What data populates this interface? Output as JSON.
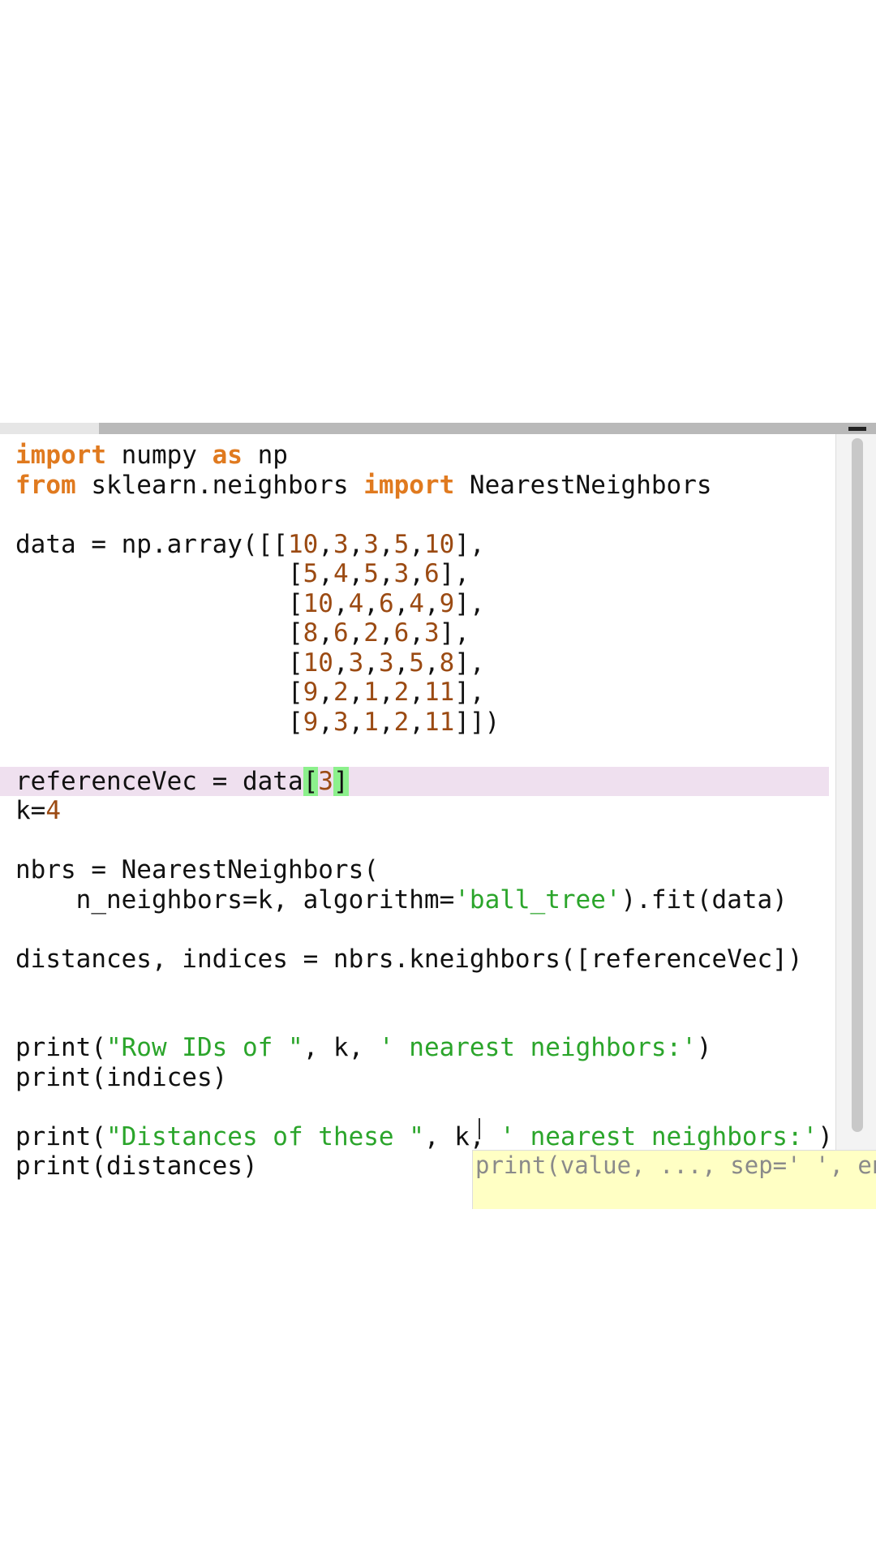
{
  "editor": {
    "highlighted_line": 10,
    "lines": [
      [
        {
          "c": "kw",
          "t": "import"
        },
        {
          "c": "",
          "t": " numpy "
        },
        {
          "c": "kw",
          "t": "as"
        },
        {
          "c": "",
          "t": " np"
        }
      ],
      [
        {
          "c": "kw",
          "t": "from"
        },
        {
          "c": "",
          "t": " sklearn.neighbors "
        },
        {
          "c": "kw",
          "t": "import"
        },
        {
          "c": "",
          "t": " NearestNeighbors"
        }
      ],
      [],
      [
        {
          "c": "",
          "t": "data = np.array([["
        },
        {
          "c": "num",
          "t": "10"
        },
        {
          "c": "",
          "t": ","
        },
        {
          "c": "num",
          "t": "3"
        },
        {
          "c": "",
          "t": ","
        },
        {
          "c": "num",
          "t": "3"
        },
        {
          "c": "",
          "t": ","
        },
        {
          "c": "num",
          "t": "5"
        },
        {
          "c": "",
          "t": ","
        },
        {
          "c": "num",
          "t": "10"
        },
        {
          "c": "",
          "t": "],"
        }
      ],
      [
        {
          "c": "",
          "t": "                  ["
        },
        {
          "c": "num",
          "t": "5"
        },
        {
          "c": "",
          "t": ","
        },
        {
          "c": "num",
          "t": "4"
        },
        {
          "c": "",
          "t": ","
        },
        {
          "c": "num",
          "t": "5"
        },
        {
          "c": "",
          "t": ","
        },
        {
          "c": "num",
          "t": "3"
        },
        {
          "c": "",
          "t": ","
        },
        {
          "c": "num",
          "t": "6"
        },
        {
          "c": "",
          "t": "],"
        }
      ],
      [
        {
          "c": "",
          "t": "                  ["
        },
        {
          "c": "num",
          "t": "10"
        },
        {
          "c": "",
          "t": ","
        },
        {
          "c": "num",
          "t": "4"
        },
        {
          "c": "",
          "t": ","
        },
        {
          "c": "num",
          "t": "6"
        },
        {
          "c": "",
          "t": ","
        },
        {
          "c": "num",
          "t": "4"
        },
        {
          "c": "",
          "t": ","
        },
        {
          "c": "num",
          "t": "9"
        },
        {
          "c": "",
          "t": "],"
        }
      ],
      [
        {
          "c": "",
          "t": "                  ["
        },
        {
          "c": "num",
          "t": "8"
        },
        {
          "c": "",
          "t": ","
        },
        {
          "c": "num",
          "t": "6"
        },
        {
          "c": "",
          "t": ","
        },
        {
          "c": "num",
          "t": "2"
        },
        {
          "c": "",
          "t": ","
        },
        {
          "c": "num",
          "t": "6"
        },
        {
          "c": "",
          "t": ","
        },
        {
          "c": "num",
          "t": "3"
        },
        {
          "c": "",
          "t": "],"
        }
      ],
      [
        {
          "c": "",
          "t": "                  ["
        },
        {
          "c": "num",
          "t": "10"
        },
        {
          "c": "",
          "t": ","
        },
        {
          "c": "num",
          "t": "3"
        },
        {
          "c": "",
          "t": ","
        },
        {
          "c": "num",
          "t": "3"
        },
        {
          "c": "",
          "t": ","
        },
        {
          "c": "num",
          "t": "5"
        },
        {
          "c": "",
          "t": ","
        },
        {
          "c": "num",
          "t": "8"
        },
        {
          "c": "",
          "t": "],"
        }
      ],
      [
        {
          "c": "",
          "t": "                  ["
        },
        {
          "c": "num",
          "t": "9"
        },
        {
          "c": "",
          "t": ","
        },
        {
          "c": "num",
          "t": "2"
        },
        {
          "c": "",
          "t": ","
        },
        {
          "c": "num",
          "t": "1"
        },
        {
          "c": "",
          "t": ","
        },
        {
          "c": "num",
          "t": "2"
        },
        {
          "c": "",
          "t": ","
        },
        {
          "c": "num",
          "t": "11"
        },
        {
          "c": "",
          "t": "],"
        }
      ],
      [
        {
          "c": "",
          "t": "                  ["
        },
        {
          "c": "num",
          "t": "9"
        },
        {
          "c": "",
          "t": ","
        },
        {
          "c": "num",
          "t": "3"
        },
        {
          "c": "",
          "t": ","
        },
        {
          "c": "num",
          "t": "1"
        },
        {
          "c": "",
          "t": ","
        },
        {
          "c": "num",
          "t": "2"
        },
        {
          "c": "",
          "t": ","
        },
        {
          "c": "num",
          "t": "11"
        },
        {
          "c": "",
          "t": "]])"
        }
      ],
      [],
      [
        {
          "c": "",
          "t": "referenceVec = data"
        },
        {
          "c": "match",
          "t": "["
        },
        {
          "c": "num",
          "t": "3"
        },
        {
          "c": "match",
          "t": "]"
        }
      ],
      [
        {
          "c": "",
          "t": "k="
        },
        {
          "c": "num",
          "t": "4"
        }
      ],
      [],
      [
        {
          "c": "",
          "t": "nbrs = NearestNeighbors("
        }
      ],
      [
        {
          "c": "",
          "t": "    n_neighbors=k, algorithm="
        },
        {
          "c": "str",
          "t": "'ball_tree'"
        },
        {
          "c": "",
          "t": ").fit(data)"
        }
      ],
      [],
      [
        {
          "c": "",
          "t": "distances, indices = nbrs.kneighbors([referenceVec])"
        }
      ],
      [],
      [],
      [
        {
          "c": "",
          "t": "print("
        },
        {
          "c": "str",
          "t": "\"Row IDs of \""
        },
        {
          "c": "",
          "t": ", k, "
        },
        {
          "c": "str",
          "t": "' nearest neighbors:'"
        },
        {
          "c": "",
          "t": ")"
        }
      ],
      [
        {
          "c": "",
          "t": "print(indices)"
        }
      ],
      [],
      [
        {
          "c": "",
          "t": "print("
        },
        {
          "c": "str",
          "t": "\"Distances of these \""
        },
        {
          "c": "",
          "t": ", k, "
        },
        {
          "c": "str",
          "t": "' nearest neighbors:'"
        },
        {
          "c": "",
          "t": ")"
        }
      ],
      [
        {
          "c": "",
          "t": "print(distances)"
        }
      ]
    ]
  },
  "tooltip": {
    "text": "print(value, ..., sep=' ', end='\\n', file=sys.stdout, flush=False)"
  },
  "colors": {
    "keyword": "#e07a1f",
    "number": "#9b4a12",
    "string": "#2ba52b",
    "line_highlight": "#efe0ef",
    "bracket_match": "#8cf08c",
    "tooltip_bg": "#ffffc4"
  }
}
